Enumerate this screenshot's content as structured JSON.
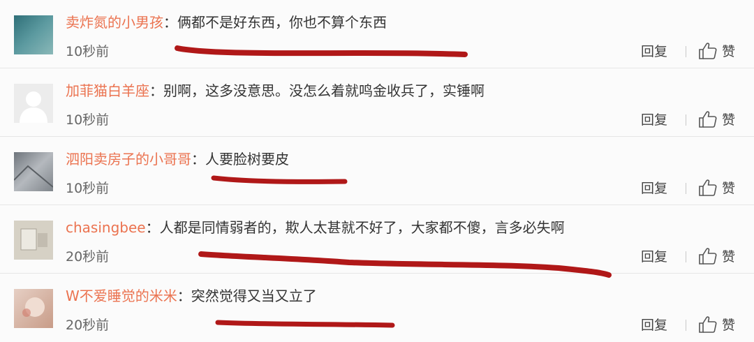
{
  "comments": [
    {
      "username": "卖炸氮的小男孩",
      "colon": "：",
      "text": "俩都不是好东西，你也不算个东西",
      "time": "10秒前",
      "reply": "回复",
      "like": "赞",
      "avatar_color": "#4a8a8f"
    },
    {
      "username": "加菲猫白羊座",
      "colon": "：",
      "text": "别啊，这多没意思。没怎么着就鸣金收兵了，实锤啊",
      "time": "10秒前",
      "reply": "回复",
      "like": "赞",
      "avatar_color": "#e9e9e9"
    },
    {
      "username": "泗阳卖房子的小哥哥",
      "colon": "：",
      "text": "人要脸树要皮",
      "time": "10秒前",
      "reply": "回复",
      "like": "赞",
      "avatar_color": "#9a9fa6"
    },
    {
      "username": "chasingbee",
      "colon": "：",
      "text": "人都是同情弱者的，欺人太甚就不好了，大家都不傻，言多必失啊",
      "time": "20秒前",
      "reply": "回复",
      "like": "赞",
      "avatar_color": "#cfcabe"
    },
    {
      "username": "W不爱睡觉的米米",
      "colon": "：",
      "text": "突然觉得又当又立了",
      "time": "20秒前",
      "reply": "回复",
      "like": "赞",
      "avatar_color": "#d9b8a8"
    }
  ],
  "colors": {
    "username": "#eb7350",
    "annotation_stroke": "#b01818"
  }
}
